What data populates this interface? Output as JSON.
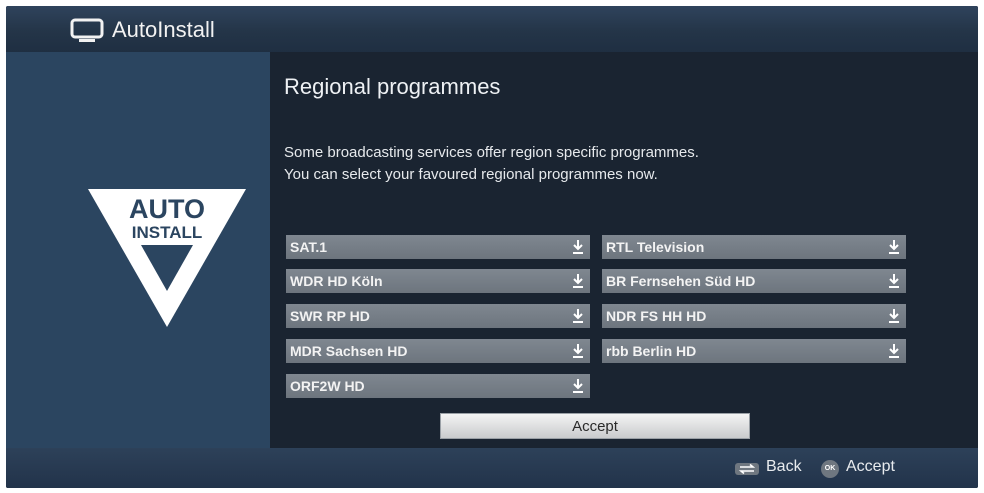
{
  "header": {
    "title": "AutoInstall",
    "icon": "tv-icon"
  },
  "logo": {
    "line1": "AUTO",
    "line2": "INSTALL"
  },
  "main": {
    "heading": "Regional programmes",
    "description_line1": "Some broadcasting services offer region specific programmes.",
    "description_line2": "You can select your favoured regional programmes now.",
    "selectors": [
      {
        "value": "SAT.1"
      },
      {
        "value": "RTL Television"
      },
      {
        "value": "WDR HD Köln"
      },
      {
        "value": "BR Fernsehen Süd HD"
      },
      {
        "value": "SWR RP HD"
      },
      {
        "value": "NDR FS HH HD"
      },
      {
        "value": "MDR Sachsen HD"
      },
      {
        "value": "rbb Berlin HD"
      },
      {
        "value": "ORF2W HD"
      }
    ],
    "accept_label": "Accept"
  },
  "footer": {
    "back_label": "Back",
    "ok_badge": "OK",
    "accept_label": "Accept"
  },
  "colors": {
    "panel": "#2b4560",
    "background": "#1a2431",
    "selector": "#767e87"
  }
}
